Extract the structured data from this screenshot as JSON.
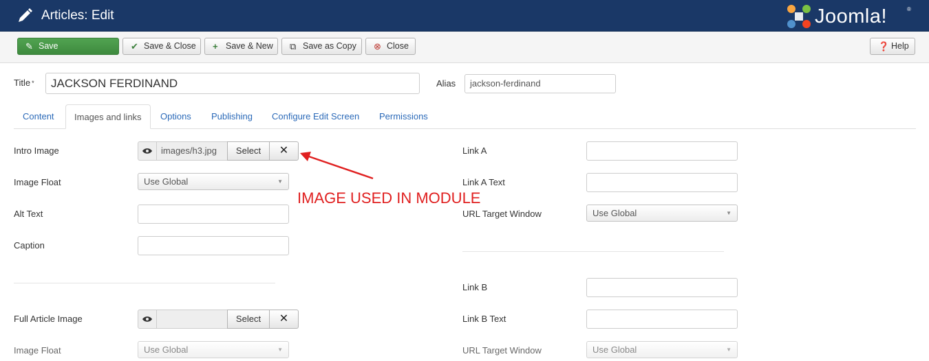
{
  "header": {
    "title": "Articles: Edit",
    "brand_name": "Joomla!",
    "brand_mark": "®",
    "bg_color": "#1a3867"
  },
  "toolbar": {
    "save": "Save",
    "save_close": "Save & Close",
    "save_new": "Save & New",
    "save_copy": "Save as Copy",
    "close": "Close",
    "help": "Help"
  },
  "form": {
    "title_label": "Title",
    "required_mark": "*",
    "title_value": "JACKSON FERDINAND",
    "alias_label": "Alias",
    "alias_value": "jackson-ferdinand"
  },
  "tabs": [
    "Content",
    "Images and links",
    "Options",
    "Publishing",
    "Configure Edit Screen",
    "Permissions"
  ],
  "active_tab": "Images and links",
  "images": {
    "intro_image_label": "Intro Image",
    "intro_image_value": "images/h3.jpg",
    "select_label": "Select",
    "image_float_label": "Image Float",
    "image_float_value": "Use Global",
    "alt_text_label": "Alt Text",
    "caption_label": "Caption",
    "full_image_label": "Full Article Image",
    "full_image_value": "",
    "full_float_label": "Image Float",
    "full_float_value": "Use Global"
  },
  "links": {
    "link_a_label": "Link A",
    "link_a_text_label": "Link A Text",
    "url_target_label": "URL Target Window",
    "url_target_value": "Use Global",
    "link_b_label": "Link B",
    "link_b_text_label": "Link B Text",
    "url_target_b_label": "URL Target Window",
    "url_target_b_value": "Use Global"
  },
  "annotation": {
    "text": "IMAGE USED IN MODULE",
    "color": "#e02020"
  }
}
